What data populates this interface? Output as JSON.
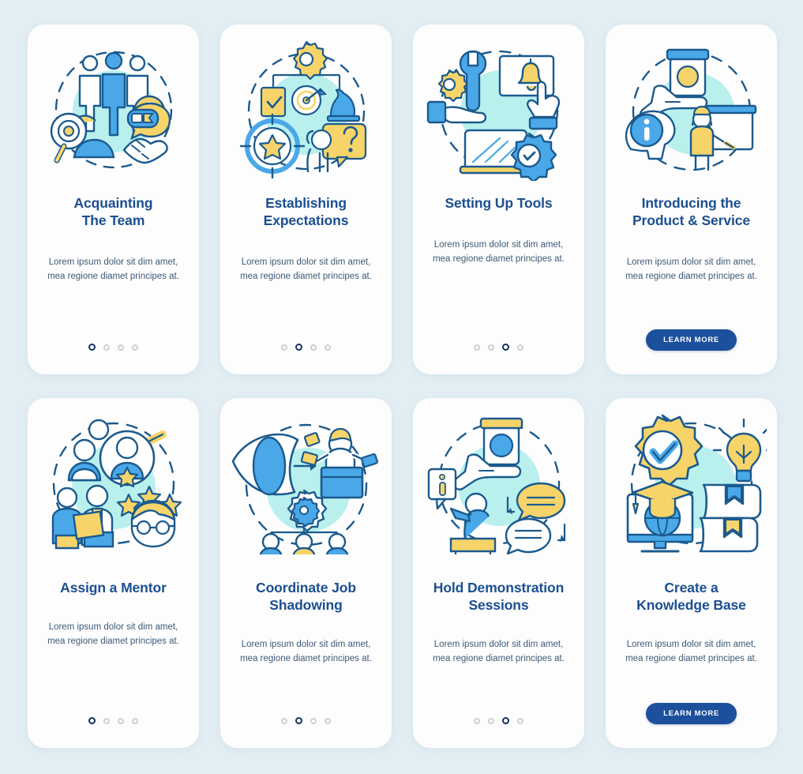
{
  "theme": {
    "page_background": "#e2eef3",
    "card_background": "#fdfdfd",
    "title_color": "#1b4f91",
    "body_color": "#3d5a77",
    "accent_blue": "#1c4f9c",
    "illustration_blue": "#4aa8e8",
    "illustration_yellow": "#f7d469",
    "illustration_mint": "#b9f0ee",
    "dot_inactive": "#cfcfcf",
    "dot_active": "#15325e"
  },
  "screens": [
    {
      "id": "acquainting-the-team",
      "title": "Acquainting The Team",
      "title_lines": [
        "Acquainting",
        "The Team"
      ],
      "body": "Lorem ipsum dolor sit dim amet, mea regione diamet principes at.",
      "illustration_name": "team-introduction-illustration",
      "footer_type": "dots",
      "dots_total": 4,
      "dots_active_index": 0
    },
    {
      "id": "establishing-expectations",
      "title": "Establishing Expectations",
      "title_lines": [
        "Establishing",
        "Expectations"
      ],
      "body": "Lorem ipsum dolor sit dim amet, mea regione diamet principes at.",
      "illustration_name": "goals-and-expectations-illustration",
      "footer_type": "dots",
      "dots_total": 4,
      "dots_active_index": 1
    },
    {
      "id": "setting-up-tools",
      "title": "Setting Up Tools",
      "title_lines": [
        "Setting Up Tools"
      ],
      "body": "Lorem ipsum dolor sit dim amet, mea regione diamet principes at.",
      "illustration_name": "tools-setup-illustration",
      "footer_type": "dots",
      "dots_total": 4,
      "dots_active_index": 2
    },
    {
      "id": "introducing-the-product-and-service",
      "title": "Introducing the Product & Service",
      "title_lines": [
        "Introducing the",
        "Product & Service"
      ],
      "body": "Lorem ipsum dolor sit dim amet, mea regione diamet principes at.",
      "illustration_name": "product-presentation-illustration",
      "footer_type": "button",
      "button_label": "LEARN MORE"
    },
    {
      "id": "assign-a-mentor",
      "title": "Assign a Mentor",
      "title_lines": [
        "Assign a Mentor"
      ],
      "body": "Lorem ipsum dolor sit dim amet, mea regione diamet principes at.",
      "illustration_name": "mentor-assignment-illustration",
      "footer_type": "dots",
      "dots_total": 4,
      "dots_active_index": 0
    },
    {
      "id": "coordinate-job-shadowing",
      "title": "Coordinate Job Shadowing",
      "title_lines": [
        "Coordinate Job",
        "Shadowing"
      ],
      "body": "Lorem ipsum dolor sit dim amet, mea regione diamet principes at.",
      "illustration_name": "job-shadowing-illustration",
      "footer_type": "dots",
      "dots_total": 4,
      "dots_active_index": 1
    },
    {
      "id": "hold-demonstration-sessions",
      "title": "Hold Demonstration Sessions",
      "title_lines": [
        "Hold Demonstration",
        "Sessions"
      ],
      "body": "Lorem ipsum dolor sit dim amet, mea regione diamet principes at.",
      "illustration_name": "demonstration-session-illustration",
      "footer_type": "dots",
      "dots_total": 4,
      "dots_active_index": 2
    },
    {
      "id": "create-a-knowledge-base",
      "title": "Create a Knowledge Base",
      "title_lines": [
        "Create a",
        "Knowledge Base"
      ],
      "body": "Lorem ipsum dolor sit dim amet, mea regione diamet principes at.",
      "illustration_name": "knowledge-base-illustration",
      "footer_type": "button",
      "button_label": "LEARN MORE"
    }
  ]
}
